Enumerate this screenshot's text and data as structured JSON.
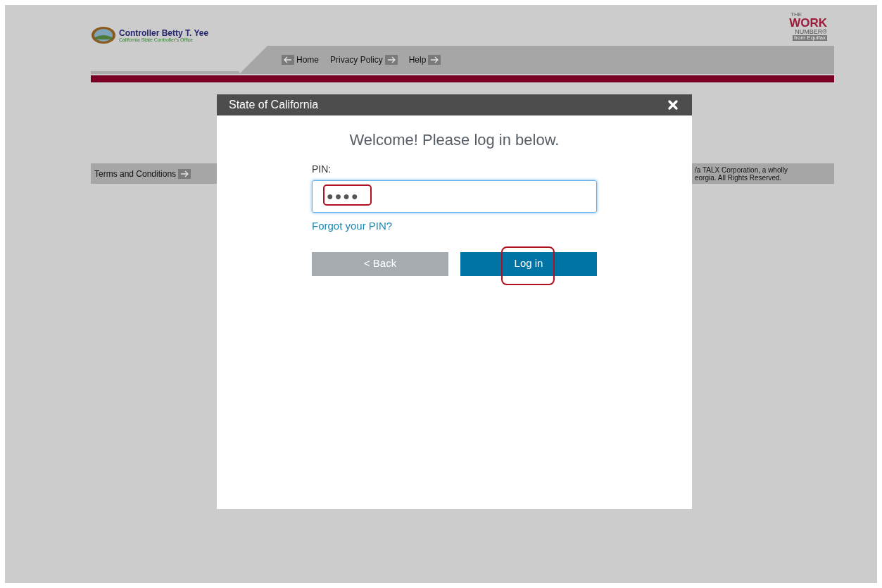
{
  "header": {
    "title": "Controller Betty T. Yee",
    "subtitle": "California State Controller's Office",
    "partner_logo": {
      "top": "THE",
      "main": "WORK",
      "sub": "NUMBER®",
      "tag": "from Equifax"
    },
    "nav": [
      {
        "label": "Home",
        "arrow_before": true
      },
      {
        "label": "Privacy Policy",
        "arrow_before": false
      },
      {
        "label": "Help",
        "arrow_before": false
      }
    ]
  },
  "footer": {
    "link": "Terms and Conditions",
    "copyright_lines": [
      "/a TALX Corporation, a wholly",
      "eorgia. All Rights Reserved."
    ]
  },
  "dialog": {
    "title": "State of California",
    "heading": "Welcome! Please log in below.",
    "pin_label": "PIN:",
    "pin_value": "●●●●",
    "forgot_link": "Forgot your PIN?",
    "back_button": "< Back",
    "login_button": "Log in"
  }
}
